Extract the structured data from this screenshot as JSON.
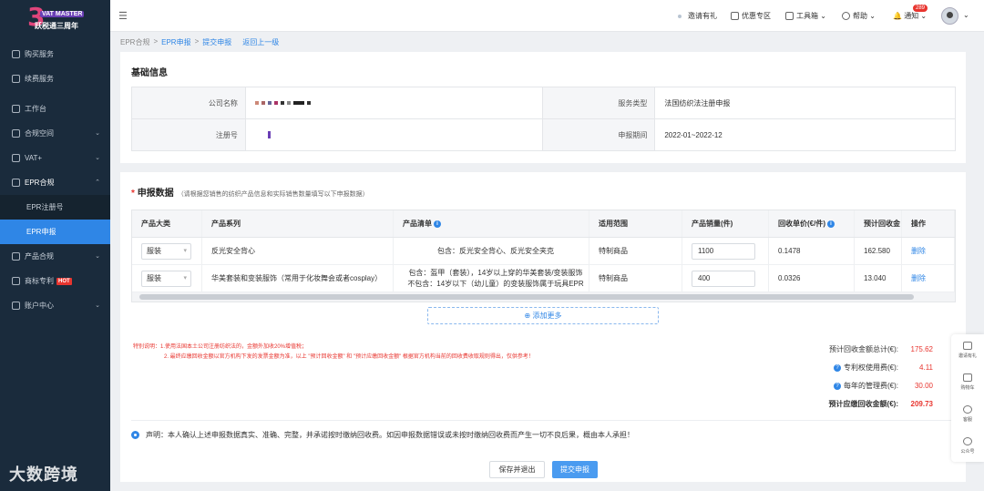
{
  "logo": {
    "big": "3",
    "line1": "VAT MASTER",
    "line2": "跃税通三周年"
  },
  "sidebar": {
    "items": [
      {
        "label": "购买服务",
        "icon": "bag-icon"
      },
      {
        "label": "续费服务",
        "icon": "renew-icon"
      },
      {
        "label": "工作台",
        "icon": "desk-icon"
      },
      {
        "label": "合规空间",
        "icon": "space-icon"
      },
      {
        "label": "VAT+",
        "icon": "vat-icon"
      },
      {
        "label": "EPR合规",
        "icon": "epr-icon"
      },
      {
        "label": "EPR注册号",
        "icon": ""
      },
      {
        "label": "EPR申报",
        "icon": ""
      },
      {
        "label": "产品合规",
        "icon": "product-icon"
      },
      {
        "label": "商标专利",
        "icon": "trademark-icon",
        "badge": "HOT"
      },
      {
        "label": "账户中心",
        "icon": "account-icon"
      }
    ]
  },
  "topbar": {
    "invite": "邀请有礼",
    "promo": "优惠专区",
    "toolbox": "工具箱",
    "help": "帮助",
    "notify": "通知",
    "notify_count": "289"
  },
  "breadcrumb": {
    "a": "EPR合规",
    "b": "EPR申报",
    "c": "提交申报",
    "back": "返回上一级"
  },
  "basic": {
    "title": "基础信息",
    "company_label": "公司名称",
    "service_label": "服务类型",
    "service_value": "法国纺织法注册申报",
    "reg_label": "注册号",
    "period_label": "申报期间",
    "period_value": "2022-01~2022-12"
  },
  "declare": {
    "title": "申报数据",
    "hint": "（请根据您销售的纺织产品信息和实际销售数量填写以下申报数据）",
    "headers": [
      "产品大类",
      "产品系列",
      "产品清单",
      "适用范围",
      "产品销量(件)",
      "回收单价(€/件)",
      "预计回收金",
      "操作"
    ],
    "rows": [
      {
        "category": "服装",
        "series": "反光安全背心",
        "list1": "包含：反光安全背心、反光安全夹克",
        "list2": "",
        "scope": "特制商品",
        "qty": "1100",
        "price": "0.1478",
        "amount": "162.580",
        "op": "删除"
      },
      {
        "category": "服装",
        "series": "华美套装和变装服饰（常用于化妆舞会或者cosplay）",
        "list1": "包含：盔甲（套装），14岁以上穿的华美套装/变装服饰",
        "list2": "不包含：14岁以下（幼儿童）的变装服饰属于玩具EPR",
        "scope": "特制商品",
        "qty": "400",
        "price": "0.0326",
        "amount": "13.040",
        "op": "删除"
      }
    ],
    "add_more": "添加更多",
    "note1": "特别说明：1.使用法国本土公司注册纺织法的，金额外加收20%增值税；",
    "note2": "2. 最终应缴回收金额以官方机构下发的发票金额为准，以上 \"预计回收金额\" 和 \"预计应缴回收金额\" 根据官方机构当前的回收费收取规则得出，仅供参考！",
    "total_label": "预计回收金额总计(€):",
    "total_value": "175.62",
    "patent_label": "专利权使用费(€):",
    "patent_value": "4.11",
    "mgmt_label": "每年的管理费(€):",
    "mgmt_value": "30.00",
    "payable_label": "预计应缴回收金额(€):",
    "payable_value": "209.73",
    "statement": "声明：本人确认上述申报数据真实、准确、完整，并承诺按时缴纳回收费。如因申报数据错误或未按时缴纳回收费而产生一切不良后果，概由本人承担！",
    "save_btn": "保存并退出",
    "submit_btn": "提交申报"
  },
  "float": [
    "邀请有礼",
    "购物车",
    "客服",
    "公众号"
  ],
  "watermark": "大数跨境"
}
